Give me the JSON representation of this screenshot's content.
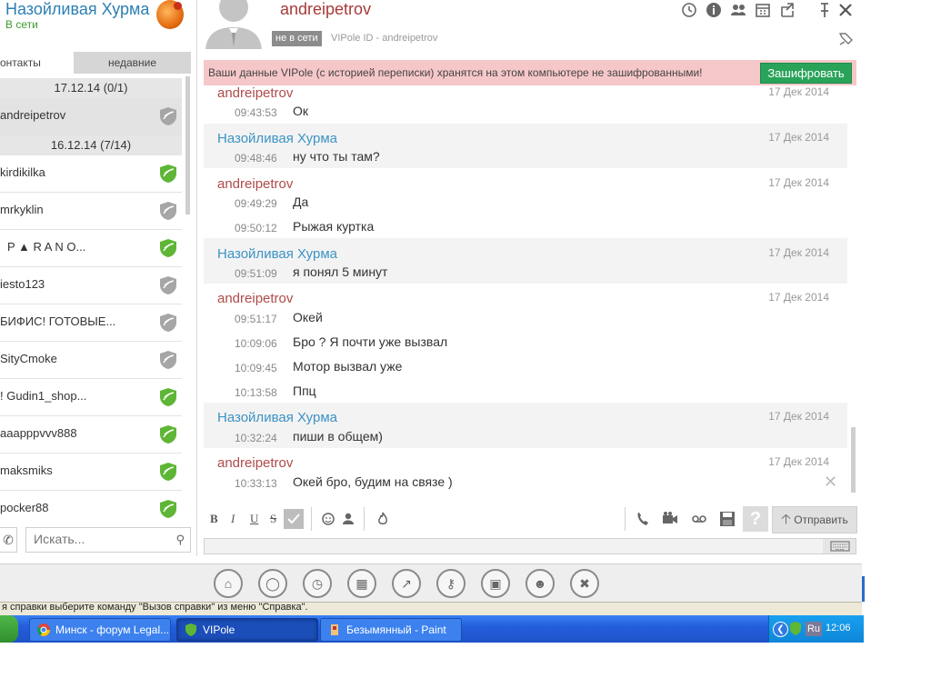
{
  "profile": {
    "name": "Назойливая Хурма",
    "status": "В сети"
  },
  "contact_tabs": {
    "contacts": "онтакты",
    "recent": "недавние"
  },
  "contact_groups": [
    {
      "date": "17.12.14 (0/1)"
    },
    {
      "date": "16.12.14 (7/14)"
    }
  ],
  "contacts": [
    {
      "name": "andreipetrov",
      "shield": "gray"
    },
    {
      "name": "kirdikilka",
      "shield": "green"
    },
    {
      "name": "mrkyklin",
      "shield": "gray"
    },
    {
      "name": "P ▲ R A N O...",
      "shield": "green"
    },
    {
      "name": "iesto123",
      "shield": "gray"
    },
    {
      "name": "БИФИС! ГОТОВЫЕ...",
      "shield": "gray"
    },
    {
      "name": "SityCmoke",
      "shield": "gray"
    },
    {
      "name": "! Gudin1_shop...",
      "shield": "green"
    },
    {
      "name": "aaapppvvv888",
      "shield": "green"
    },
    {
      "name": "maksmiks",
      "shield": "green"
    },
    {
      "name": "pocker88",
      "shield": "green"
    }
  ],
  "search": {
    "placeholder": "Искать..."
  },
  "chat": {
    "user_name": "andreipetrov",
    "status": "не в сети",
    "vipole_id": "VIPole ID - andreipetrov"
  },
  "warning": {
    "text": "Ваши данные VIPole (с историей переписки) хранятся на этом компьютере не зашифрованными!",
    "button": "Зашифровать"
  },
  "messages": [
    {
      "sender": "andreipetrov",
      "who": "them",
      "date": "17 Дек 2014",
      "lines": [
        {
          "time": "09:43:53",
          "text": "Ок"
        }
      ]
    },
    {
      "sender": "Назойливая Хурма",
      "who": "me",
      "date": "17 Дек 2014",
      "lines": [
        {
          "time": "09:48:46",
          "text": "ну что ты там?"
        }
      ]
    },
    {
      "sender": "andreipetrov",
      "who": "them",
      "date": "17 Дек 2014",
      "lines": [
        {
          "time": "09:49:29",
          "text": "Да"
        },
        {
          "time": "09:50:12",
          "text": "Рыжая куртка"
        }
      ]
    },
    {
      "sender": "Назойливая Хурма",
      "who": "me",
      "date": "17 Дек 2014",
      "lines": [
        {
          "time": "09:51:09",
          "text": "я понял 5 минут"
        }
      ]
    },
    {
      "sender": "andreipetrov",
      "who": "them",
      "date": "17 Дек 2014",
      "lines": [
        {
          "time": "09:51:17",
          "text": "Окей"
        },
        {
          "time": "10:09:06",
          "text": "Бро   ? Я почти уже вызвал"
        },
        {
          "time": "10:09:45",
          "text": "Мотор вызвал уже"
        },
        {
          "time": "10:13:58",
          "text": "Ппц"
        }
      ]
    },
    {
      "sender": "Назойливая Хурма",
      "who": "me",
      "date": "17 Дек 2014",
      "lines": [
        {
          "time": "10:32:24",
          "text": "пиши в общем)"
        }
      ]
    },
    {
      "sender": "andreipetrov",
      "who": "them",
      "date": "17 Дек 2014",
      "lines": [
        {
          "time": "10:33:13",
          "text": "Окей бро,  будим на связе )"
        }
      ]
    }
  ],
  "toolbar": {
    "bold": "B",
    "italic": "I",
    "underline": "U",
    "strike": "S",
    "send": "Отправить"
  },
  "statusbar": {
    "text": "я справки выберите команду \"Вызов справки\" из меню \"Справка\"."
  },
  "taskbar": {
    "tasks": [
      "Минск - форум Legal...",
      "VIPole",
      "Безымянный - Paint"
    ],
    "lang": "Ru",
    "clock": "12:06"
  },
  "colors": {
    "accent_green": "#2aa35a",
    "warning_bg": "#f6c7c9",
    "sender_them": "#b04a4a",
    "sender_me": "#3d93c4"
  }
}
